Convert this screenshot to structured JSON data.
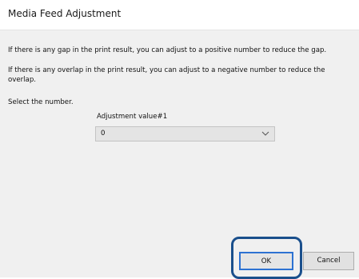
{
  "dialog": {
    "title": "Media Feed Adjustment",
    "message_gap": "If there is any gap in the print result, you can adjust to a positive number to reduce the gap.",
    "message_overlap": "If there is any overlap in the print result, you can adjust to a negative number to reduce the overlap.",
    "instruction": "Select the number."
  },
  "adjustment": {
    "label": "Adjustment value#1",
    "selected_value": "0"
  },
  "buttons": {
    "ok_label": "OK",
    "cancel_label": "Cancel"
  },
  "colors": {
    "highlight": "#1a4f8c",
    "focus_border": "#2d72d2"
  }
}
